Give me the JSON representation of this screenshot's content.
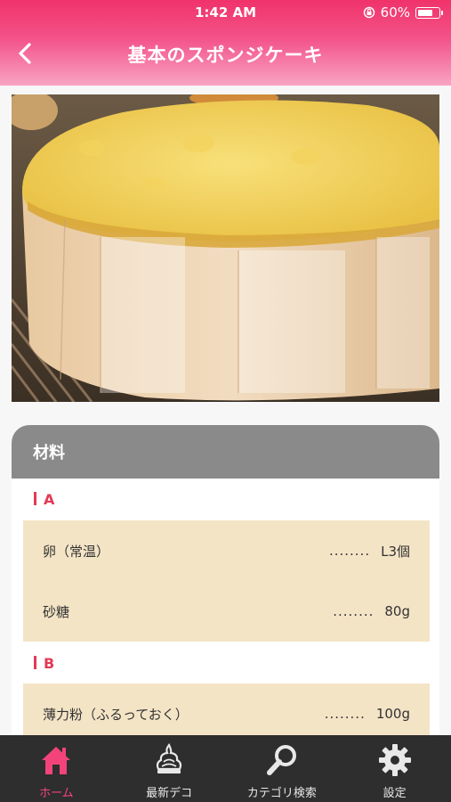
{
  "status_bar": {
    "time": "1:42 AM",
    "battery": "60%"
  },
  "nav": {
    "title": "基本のスポンジケーキ"
  },
  "ingredients": {
    "section_title": "材料",
    "groups": [
      {
        "label": "A",
        "items": [
          {
            "name": "卵（常温）",
            "dots": "........",
            "qty": "L3個"
          },
          {
            "name": "砂糖",
            "dots": "........",
            "qty": "80g"
          }
        ]
      },
      {
        "label": "B",
        "items": [
          {
            "name": "薄力粉（ふるっておく）",
            "dots": "........",
            "qty": "100g"
          }
        ]
      }
    ]
  },
  "tabs": [
    {
      "label": "ホーム",
      "icon": "home-icon",
      "active": true
    },
    {
      "label": "最新デコ",
      "icon": "cream-icon",
      "active": false
    },
    {
      "label": "カテゴリ検索",
      "icon": "search-icon",
      "active": false
    },
    {
      "label": "設定",
      "icon": "gear-icon",
      "active": false
    }
  ],
  "colors": {
    "accent": "#f2447a",
    "header_top": "#f0336a",
    "section_header": "#8a8a8a",
    "ingredient_bg": "#f4e4c6",
    "group_label": "#e23b55",
    "tab_bar": "#2e2e2e"
  }
}
